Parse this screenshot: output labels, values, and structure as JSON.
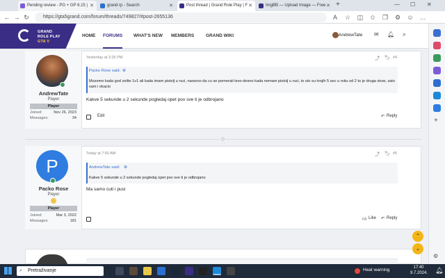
{
  "tabs": [
    {
      "label": "Pending review - PG + GP 6.15 |",
      "color": "#7b5cd6"
    },
    {
      "label": "grand rp - Search",
      "color": "#2c6fd1"
    },
    {
      "label": "Post thread | Grand Role Play | F",
      "color": "#3a2d86"
    },
    {
      "label": "ImgBB — Upload Image — Free",
      "color": "#3a2d86"
    }
  ],
  "address": {
    "url": "https://gta5grand.com/forum/threads/749827/#post-2655136"
  },
  "site": {
    "logo_line1": "GRAND",
    "logo_line2": "ROLE PLAY",
    "logo_line3": "GTA V",
    "nav": [
      "HOME",
      "FORUMS",
      "WHAT'S NEW",
      "MEMBERS",
      "GRAND WIKI"
    ],
    "user": "AndrewTate"
  },
  "posts": [
    {
      "time": "Yesterday at 3:25 PM",
      "number": "#4",
      "author": "AndrewTate",
      "title": "Player",
      "badge": "Player",
      "joined_label": "Joined:",
      "joined": "Nov 26, 2023",
      "messages_label": "Messages:",
      "messages": "34",
      "quote_head": "Packo Rose said:",
      "quote": "Mozemo kada god zelite 1v1 ali kada imam pistolj u ruci, naravno da cu se pomerati levo-desno kada nemam pistolj u ruci, to sto su tvojih 5 sec u roku od 2 to je druga stvar, zato sam i okacio",
      "body": "Kakve 5 sekunde u 2 sekunde pogledaj opet pov sve ti je odbrojano",
      "actions": {
        "edit": "Edit",
        "reply": "Reply"
      }
    },
    {
      "time": "Today at 7:50 AM",
      "number": "#5",
      "author": "Packo Rose",
      "title": "Player",
      "badge": "Player",
      "avatar_letter": "P",
      "joined_label": "Joined:",
      "joined": "Mar 3, 2022",
      "messages_label": "Messages:",
      "messages": "181",
      "quote_head": "AndrewTate said:",
      "quote": "Kakve 5 sekunde u 2 sekunde pogledaj opet pov sve ti je odbrojano",
      "body": "Ma samo cuti i pusi",
      "actions": {
        "like": "Like",
        "reply": "Reply"
      }
    }
  ],
  "taskbar": {
    "search": "Pretraživanje",
    "warning": "Heat warning",
    "time": "17:40",
    "date": "9.7.2024."
  }
}
